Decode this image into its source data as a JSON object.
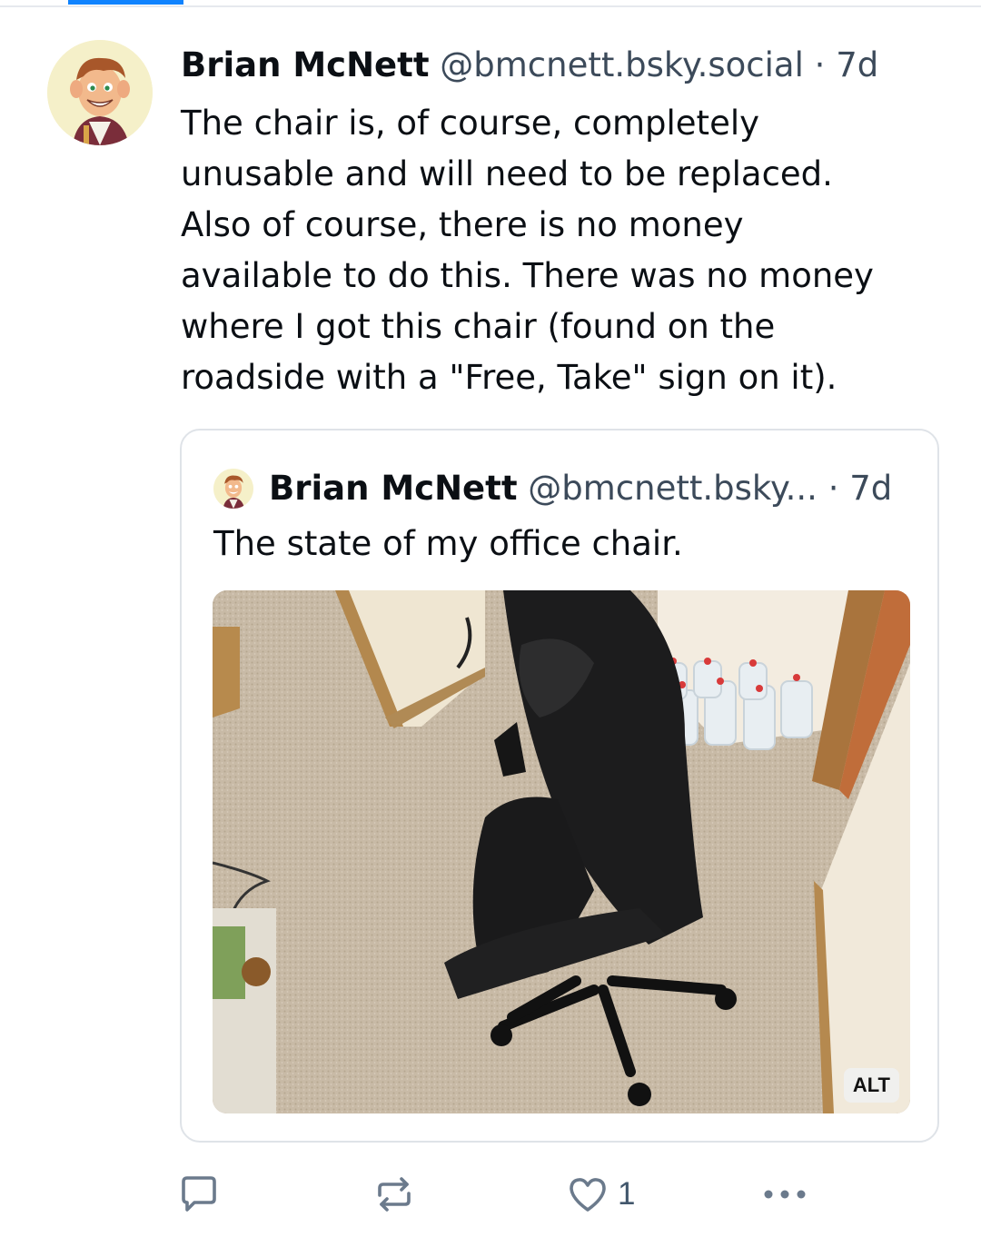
{
  "post": {
    "author_name": "Brian McNett",
    "author_handle": "@bmcnett.bsky.social",
    "separator": "·",
    "time": "7d",
    "text_lines": [
      "The chair is, of course, completely",
      "unusable and will need to be replaced.",
      "Also of course, there is no money",
      "available to do this. There was no money",
      "where I got this chair (found on the",
      "roadside with a \"Free, Take\" sign on it)."
    ]
  },
  "quote": {
    "author_name": "Brian McNett",
    "author_handle": "@bmcnett.bsky...",
    "separator": "·",
    "time": "7d",
    "text": "The state of my office chair.",
    "image_badge": "ALT"
  },
  "actions": {
    "reply_icon": "speech-bubble-icon",
    "repost_icon": "repost-icon",
    "like_icon": "heart-icon",
    "like_count": "1",
    "more_icon": "ellipsis-icon"
  },
  "colors": {
    "accent": "#1083fe",
    "text": "#0b0f14",
    "muted": "#3c4a5a",
    "icon": "#6b7a8c",
    "border": "#dfe3e8"
  }
}
